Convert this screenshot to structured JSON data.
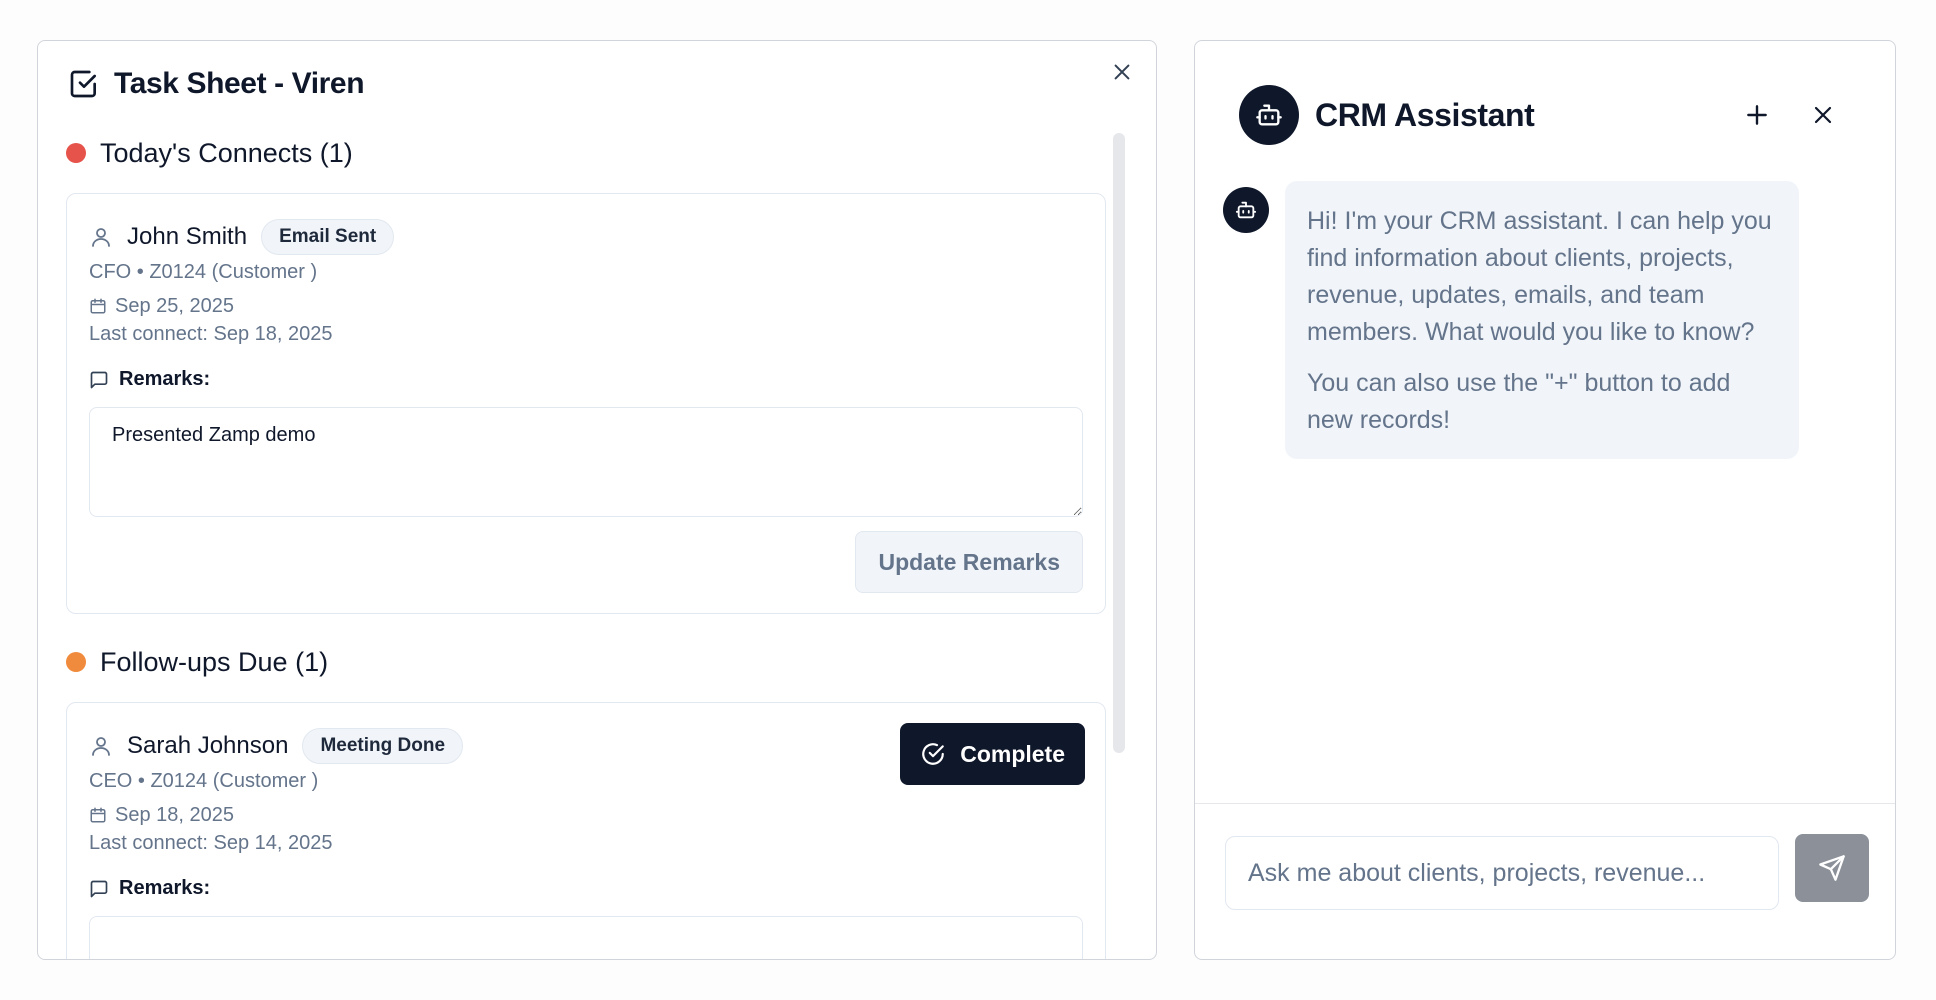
{
  "task_sheet": {
    "title": "Task Sheet - Viren",
    "sections": [
      {
        "title": "Today's Connects (1)",
        "dot_color": "#e5534b",
        "card": {
          "name": "John Smith",
          "badge": "Email Sent",
          "role_line": "CFO • Z0124 (Customer )",
          "date": "Sep 25, 2025",
          "last_connect": "Last connect: Sep 18, 2025",
          "remarks_label": "Remarks:",
          "remarks_value": "Presented Zamp demo",
          "update_button": "Update Remarks"
        }
      },
      {
        "title": "Follow-ups Due (1)",
        "dot_color": "#f08a3c",
        "card": {
          "name": "Sarah Johnson",
          "badge": "Meeting Done",
          "role_line": "CEO • Z0124 (Customer )",
          "date": "Sep 18, 2025",
          "last_connect": "Last connect: Sep 14, 2025",
          "remarks_label": "Remarks:",
          "complete_button": "Complete"
        }
      }
    ]
  },
  "crm": {
    "title": "CRM Assistant",
    "messages": [
      {
        "from": "bot",
        "paragraphs": [
          "Hi! I'm your CRM assistant. I can help you find information about clients, projects, revenue, updates, emails, and team members. What would you like to know?",
          "You can also use the \"+\" button to add new records!"
        ]
      }
    ],
    "input_placeholder": "Ask me about clients, projects, revenue..."
  },
  "colors": {
    "primary_dark": "#0f172a",
    "muted_text": "#64748b",
    "send_button": "#8b9099"
  },
  "icons": [
    "check-square-icon",
    "close-icon",
    "user-icon",
    "calendar-icon",
    "message-square-icon",
    "check-circle-icon",
    "bot-icon",
    "plus-icon",
    "send-icon"
  ]
}
